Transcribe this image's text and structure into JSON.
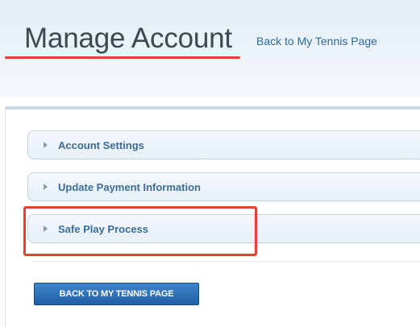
{
  "header": {
    "title": "Manage Account",
    "back_link": "Back to My Tennis Page"
  },
  "accordion": {
    "items": [
      {
        "label": "Account Settings",
        "icon": "triangle-right-icon",
        "expanded": false
      },
      {
        "label": "Update Payment Information",
        "icon": "triangle-right-icon",
        "expanded": false
      },
      {
        "label": "Safe Play Process",
        "icon": "triangle-right-icon",
        "expanded": false,
        "highlighted": true
      }
    ]
  },
  "footer": {
    "back_button_label": "BACK TO MY TENNIS PAGE"
  },
  "colors": {
    "highlight": "#e8402f",
    "link": "#2f6a9c",
    "accordion_label": "#3c6c96",
    "button": "#2a6fb5"
  }
}
